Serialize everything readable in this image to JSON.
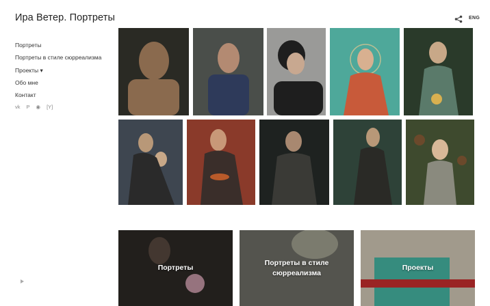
{
  "site": {
    "title": "Ира Ветер. Портреты"
  },
  "header": {
    "lang_label": "ENG",
    "share_icon": "share-icon"
  },
  "nav": {
    "items": [
      {
        "label": "Портреты"
      },
      {
        "label": "Портреты в стиле сюрреализма"
      },
      {
        "label": "Проекты  ▾"
      },
      {
        "label": "Обо мне"
      },
      {
        "label": "Контакт"
      }
    ]
  },
  "social": {
    "items": [
      {
        "icon": "vk-icon",
        "glyph": "vk"
      },
      {
        "icon": "pinterest-icon",
        "glyph": "P"
      },
      {
        "icon": "livejournal-icon",
        "glyph": "◉"
      },
      {
        "icon": "yandex-icon",
        "glyph": "[Y]"
      }
    ]
  },
  "gallery": {
    "row1": [
      {
        "name": "photo-portrait-woman-checkered-coat",
        "bg": "#2a2a24",
        "fig": "#8a6a4e"
      },
      {
        "name": "photo-portrait-red-haired-woman-blue-dress",
        "bg": "#4a4e4a",
        "fig": "#b38a72"
      },
      {
        "name": "photo-portrait-woman-short-hair-black",
        "bg": "#9a9a98",
        "fig": "#1e1e1e"
      },
      {
        "name": "photo-portrait-woman-red-dress-teal",
        "bg": "#4ea89a",
        "fig": "#c85a3a"
      },
      {
        "name": "photo-portrait-girl-green-dress",
        "bg": "#2a3a2a",
        "fig": "#5a7a6a"
      }
    ],
    "row2": [
      {
        "name": "photo-portrait-mother-daughter",
        "bg": "#3e4650",
        "fig": "#2a2a2a"
      },
      {
        "name": "photo-portrait-woman-red-background-bowl",
        "bg": "#8a3a2a",
        "fig": "#3a2e2a"
      },
      {
        "name": "photo-portrait-woman-dark-with-bird",
        "bg": "#1e2220",
        "fig": "#3a3a36"
      },
      {
        "name": "photo-portrait-woman-green-background",
        "bg": "#2e4238",
        "fig": "#2a2a26"
      },
      {
        "name": "photo-portrait-girl-floral-background",
        "bg": "#3e4a2e",
        "fig": "#8a8a7e"
      }
    ]
  },
  "categories": {
    "cards": [
      {
        "label": "Портреты",
        "bg": "#2e2a26",
        "accent": "#c89aa8"
      },
      {
        "label": "Портреты в стиле сюрреализма",
        "bg": "#6a6a62",
        "accent": "#9a9a8a"
      },
      {
        "label": "Проекты",
        "bg": "#b8b0a0",
        "accent": "#3ea090"
      }
    ]
  }
}
